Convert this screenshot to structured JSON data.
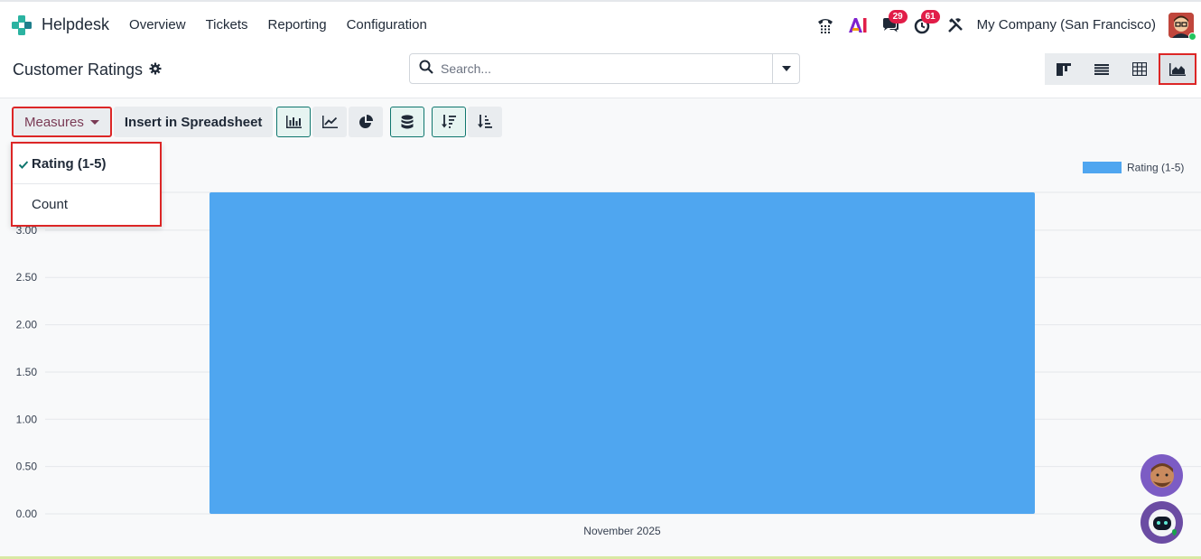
{
  "navbar": {
    "app_name": "Helpdesk",
    "menu": [
      "Overview",
      "Tickets",
      "Reporting",
      "Configuration"
    ],
    "chat_badge": "29",
    "activity_badge": "61",
    "company": "My Company (San Francisco)"
  },
  "control": {
    "title": "Customer Ratings",
    "search_placeholder": "Search..."
  },
  "toolbar": {
    "measures_label": "Measures",
    "spreadsheet_label": "Insert in Spreadsheet"
  },
  "measures_menu": {
    "items": [
      {
        "label": "Rating (1-5)",
        "selected": true
      },
      {
        "label": "Count",
        "selected": false
      }
    ]
  },
  "colors": {
    "bar": "#4fa6f0",
    "accent_red": "#dc2626",
    "badge": "#e11d48"
  },
  "chart_data": {
    "type": "bar",
    "categories": [
      "November 2025"
    ],
    "series": [
      {
        "name": "Rating (1-5)",
        "values": [
          3.4
        ]
      }
    ],
    "y_ticks": [
      "0.00",
      "0.50",
      "1.00",
      "1.50",
      "2.00",
      "2.50",
      "3.00"
    ],
    "ylim": [
      0,
      3.4
    ],
    "grid": true,
    "legend": "top-right"
  }
}
